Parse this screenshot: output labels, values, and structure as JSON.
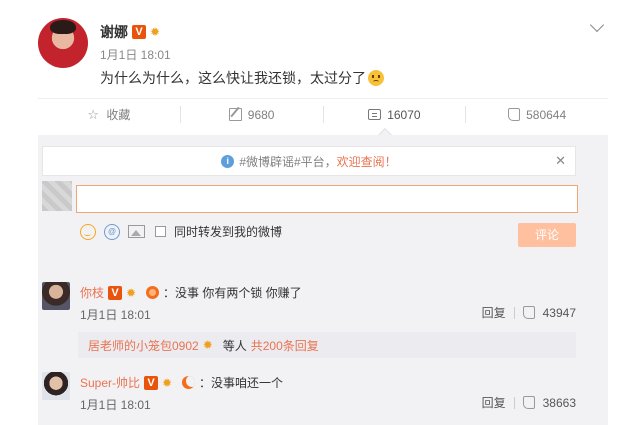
{
  "post": {
    "author": "谢娜",
    "time": "1月1日 18:01",
    "text": "为什么为什么，这么快让我还锁，太过分了"
  },
  "actions": {
    "favorite": "收藏",
    "repost": "9680",
    "comment": "16070",
    "like": "580644"
  },
  "comment_box": {
    "notice_topic": "#微博辟谣#平台，",
    "notice_welcome": "欢迎查阅！",
    "forward_label": "同时转发到我的微博",
    "submit_label": "评论"
  },
  "comments": [
    {
      "name": "你枝",
      "text": "：没事 你有两个锁 你赚了",
      "time": "1月1日 18:01",
      "reply_label": "回复",
      "likes": "43947",
      "replies": {
        "user": "居老师的小笼包0902",
        "mid": "等人",
        "count": "共200条回复"
      }
    },
    {
      "name": "Super-帅比",
      "text": "：没事咱还一个",
      "time": "1月1日 18:01",
      "reply_label": "回复",
      "likes": "38663"
    }
  ],
  "colors": {
    "accent": "#eb7350",
    "vip_badge": "#e8540c",
    "panel_bg": "#f2f2f5"
  }
}
